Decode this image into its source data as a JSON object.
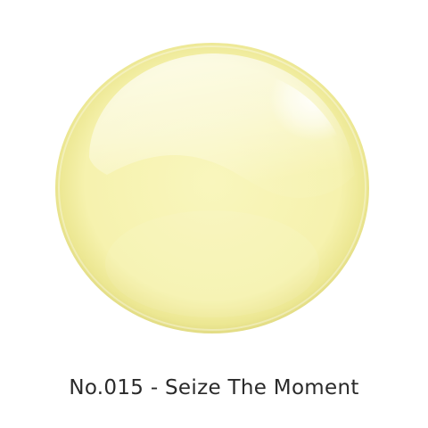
{
  "product": {
    "shade_name": "No.015 - Seize The Moment",
    "swatch_color": "#f7f4b4",
    "swatch_rim_color": "#e4e08a",
    "highlight_color": "#ffffff"
  }
}
